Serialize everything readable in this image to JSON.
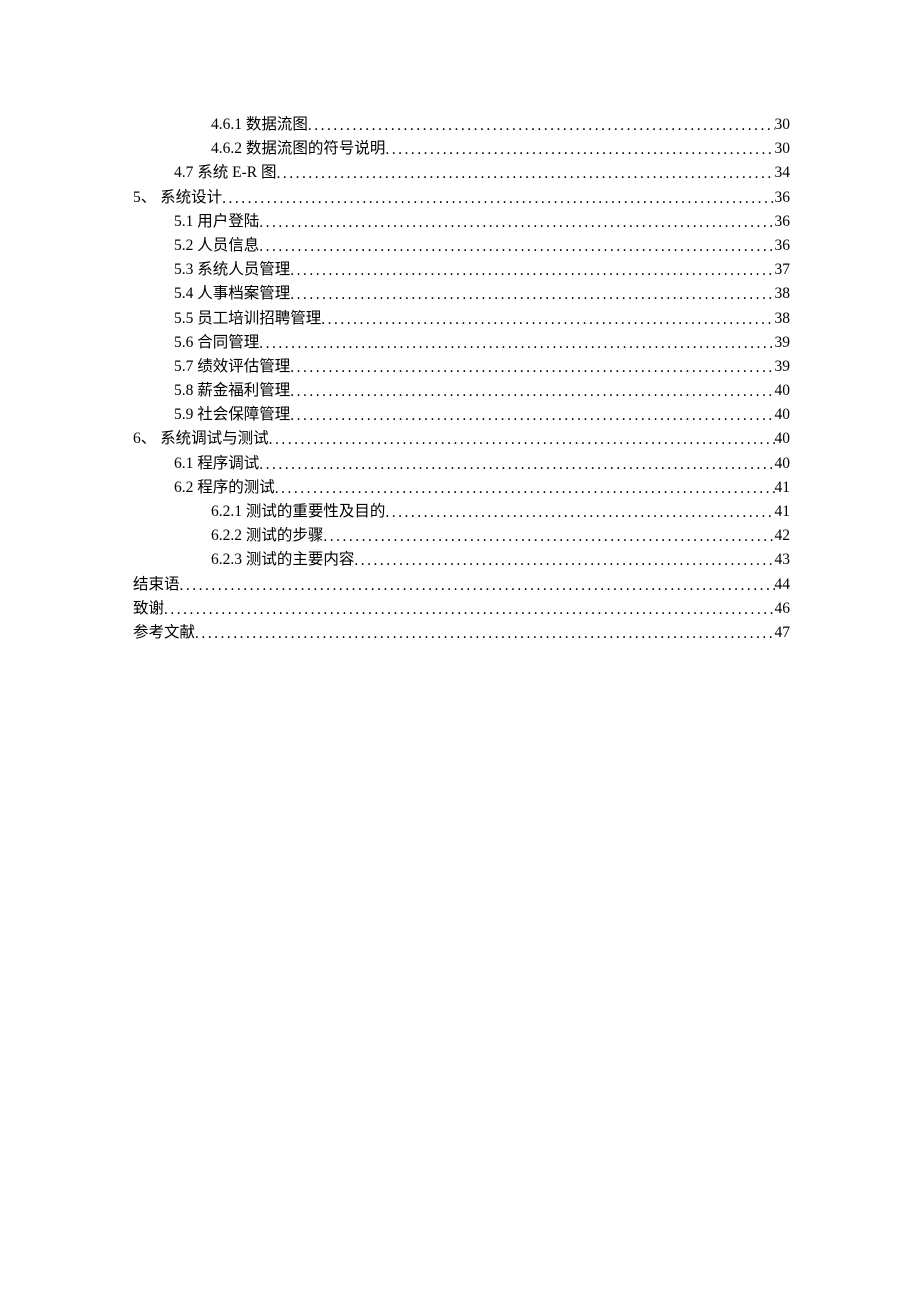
{
  "toc": [
    {
      "indent": 2,
      "label": "4.6.1 数据流图",
      "page": "30"
    },
    {
      "indent": 2,
      "label": "4.6.2 数据流图的符号说明",
      "page": "30"
    },
    {
      "indent": 1,
      "label": "4.7 系统 E-R 图 ",
      "page": "34"
    },
    {
      "indent": 0,
      "label": "5、 系统设计",
      "page": "36"
    },
    {
      "indent": 1,
      "label": "5.1  用户登陆",
      "page": "36"
    },
    {
      "indent": 1,
      "label": "5.2  人员信息",
      "page": "36"
    },
    {
      "indent": 1,
      "label": "5.3  系统人员管理",
      "page": "37"
    },
    {
      "indent": 1,
      "label": "5.4  人事档案管理",
      "page": "38"
    },
    {
      "indent": 1,
      "label": "5.5    员工培训招聘管理",
      "page": "38"
    },
    {
      "indent": 1,
      "label": "5.6  合同管理",
      "page": "39"
    },
    {
      "indent": 1,
      "label": "5.7  绩效评估管理",
      "page": "39"
    },
    {
      "indent": 1,
      "label": "5.8  薪金福利管理",
      "page": "40"
    },
    {
      "indent": 1,
      "label": "5.9  社会保障管理",
      "page": "40"
    },
    {
      "indent": 0,
      "label": "6、 系统调试与测试",
      "page": "40"
    },
    {
      "indent": 1,
      "label": "6.1  程序调试",
      "page": "40"
    },
    {
      "indent": 1,
      "label": "6.2  程序的测试",
      "page": "41"
    },
    {
      "indent": 2,
      "label": "6.2.1  测试的重要性及目的",
      "page": "41"
    },
    {
      "indent": 2,
      "label": "6.2.2  测试的步骤",
      "page": "42"
    },
    {
      "indent": 2,
      "label": "6.2.3  测试的主要内容",
      "page": "43"
    },
    {
      "indent": 0,
      "label": "结束语",
      "page": "44"
    },
    {
      "indent": 0,
      "label": "致谢",
      "page": "46"
    },
    {
      "indent": 0,
      "label": "参考文献",
      "page": "47"
    }
  ]
}
